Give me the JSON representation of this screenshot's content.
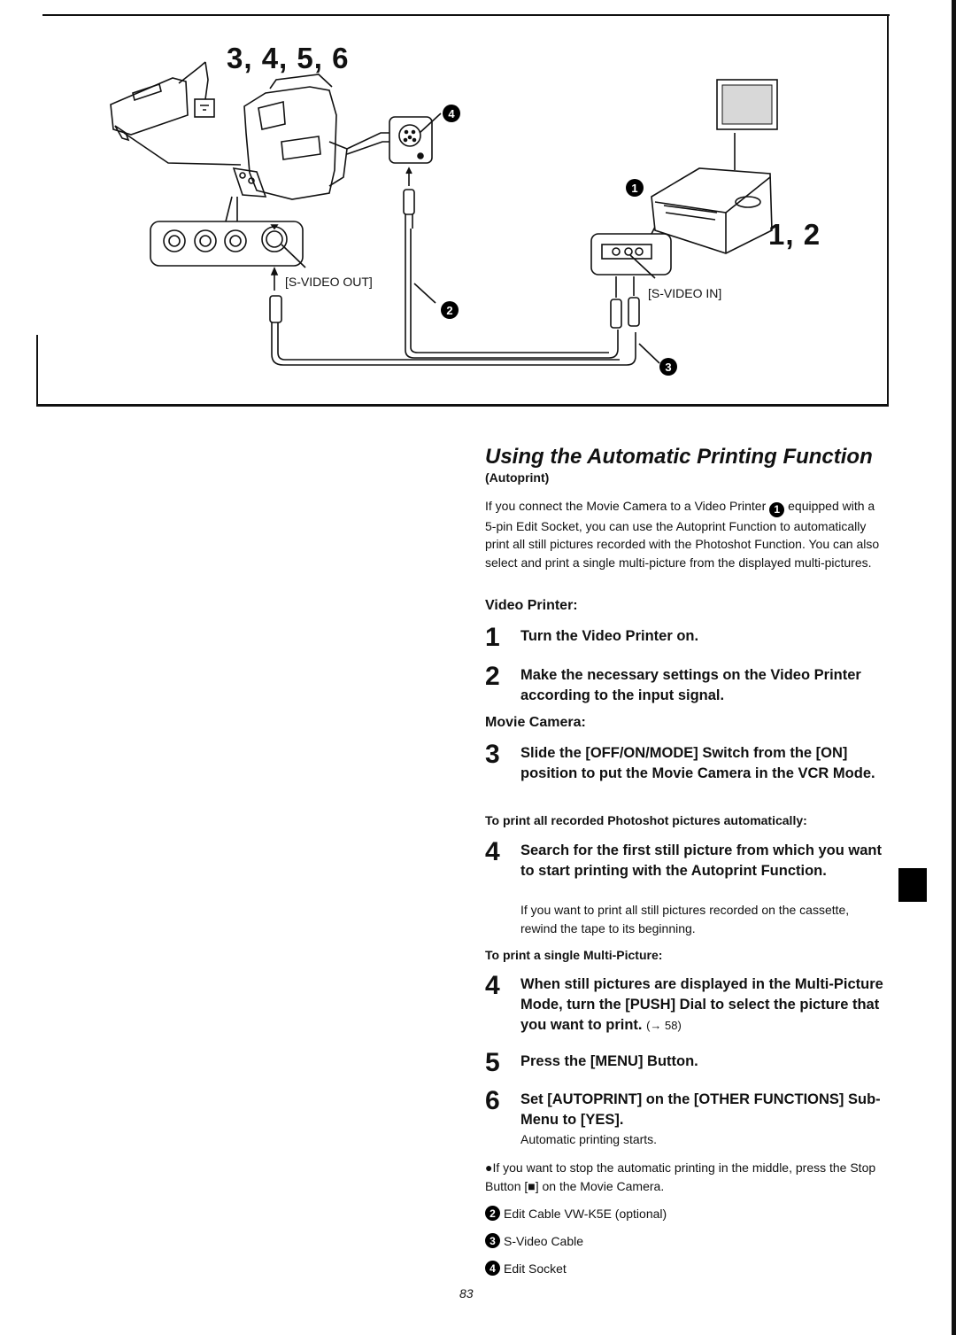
{
  "diagram": {
    "step_labels_camera": "3, 4, 5, 6",
    "step_labels_printer": "1, 2",
    "port_label_out": "[S-VIDEO OUT]",
    "port_label_in": "[S-VIDEO IN]",
    "callouts": {
      "c1": "1",
      "c2": "2",
      "c3": "3",
      "c4": "4"
    }
  },
  "section": {
    "title": "Using the Automatic Printing Function",
    "subtitle": "(Autoprint)",
    "intro_part1": "If you connect the Movie Camera to a Video Printer",
    "intro_ref": "1",
    "intro_part2": "equipped with a 5-pin Edit Socket, you can use the Autoprint Function to automatically print all still pictures recorded with the Photoshot Function. You can also select and print a single multi-picture from the displayed multi-pictures."
  },
  "video_printer": {
    "heading": "Video Printer:",
    "steps": [
      {
        "num": "1",
        "text": "Turn the Video Printer on."
      },
      {
        "num": "2",
        "text": "Make the necessary settings on the Video Printer according to the input signal."
      }
    ]
  },
  "movie_camera": {
    "heading": "Movie Camera:",
    "step3": {
      "num": "3",
      "text": "Slide the [OFF/ON/MODE] Switch from the [ON] position to put the Movie Camera in the VCR Mode."
    },
    "auto_heading": "To print all recorded Photoshot pictures automatically:",
    "step4a": {
      "num": "4",
      "text": "Search for the first still picture from which you want to start printing with the Autoprint Function.",
      "note": "If you want to print all still pictures recorded on the cassette, rewind the tape to its beginning."
    },
    "single_heading": "To print a single Multi-Picture:",
    "step4b": {
      "num": "4",
      "text": "When still pictures are displayed in the Multi-Picture Mode, turn the [PUSH] Dial to select the picture that you want to print.",
      "ref": "(→ 58)"
    },
    "step5": {
      "num": "5",
      "text": "Press the [MENU] Button."
    },
    "step6": {
      "num": "6",
      "text": "Set [AUTOPRINT] on the [OTHER FUNCTIONS] Sub-Menu to [YES].",
      "note": "Automatic printing starts."
    }
  },
  "bullet_note": "●If you want to stop the automatic printing in the middle, press the Stop Button [■] on the Movie Camera.",
  "legend": [
    {
      "num": "2",
      "label": "Edit Cable VW-K5E (optional)"
    },
    {
      "num": "3",
      "label": "S-Video Cable"
    },
    {
      "num": "4",
      "label": "Edit Socket"
    }
  ],
  "page_number": "83"
}
